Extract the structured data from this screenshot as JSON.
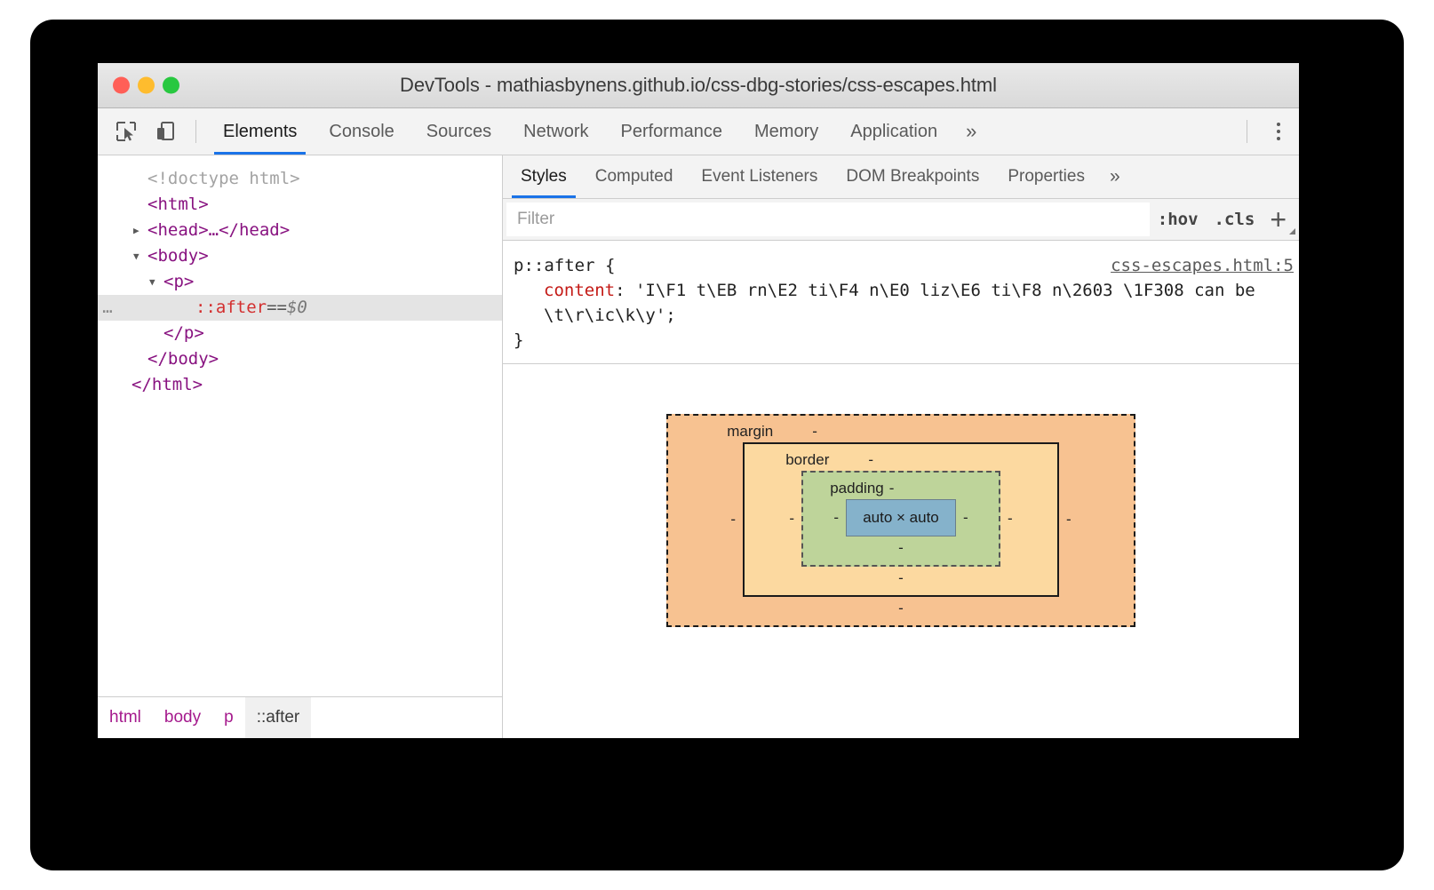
{
  "window": {
    "title": "DevTools - mathiasbynens.github.io/css-dbg-stories/css-escapes.html",
    "traffic_lights": {
      "close": "close-window",
      "minimize": "minimize-window",
      "zoom": "zoom-window"
    }
  },
  "toolbar": {
    "inspect_icon": "inspect-element-icon",
    "device_icon": "device-toolbar-icon",
    "menu_icon": "more-options-kebab-icon",
    "tabs": [
      {
        "label": "Elements",
        "active": true
      },
      {
        "label": "Console",
        "active": false
      },
      {
        "label": "Sources",
        "active": false
      },
      {
        "label": "Network",
        "active": false
      },
      {
        "label": "Performance",
        "active": false
      },
      {
        "label": "Memory",
        "active": false
      },
      {
        "label": "Application",
        "active": false
      }
    ],
    "more_label": "»"
  },
  "dom_tree": {
    "rows": [
      {
        "indent": 1,
        "twisty": "",
        "ellipsis": false,
        "selected": false,
        "parts": [
          {
            "text": "<!doctype html>",
            "cls": "tk-doctype"
          }
        ]
      },
      {
        "indent": 1,
        "twisty": "",
        "ellipsis": false,
        "selected": false,
        "parts": [
          {
            "text": "<html>",
            "cls": "tk-tag"
          }
        ]
      },
      {
        "indent": 1,
        "twisty": "▶",
        "ellipsis": false,
        "selected": false,
        "parts": [
          {
            "text": "<head>…</head>",
            "cls": "tk-tag"
          }
        ]
      },
      {
        "indent": 1,
        "twisty": "▼",
        "ellipsis": false,
        "selected": false,
        "parts": [
          {
            "text": "<body>",
            "cls": "tk-tag"
          }
        ]
      },
      {
        "indent": 2,
        "twisty": "▼",
        "ellipsis": false,
        "selected": false,
        "parts": [
          {
            "text": "<p>",
            "cls": "tk-tag"
          }
        ]
      },
      {
        "indent": 4,
        "twisty": "",
        "ellipsis": true,
        "selected": true,
        "parts": [
          {
            "text": "::after",
            "cls": "tk-pseudo"
          },
          {
            "text": " == ",
            "cls": "tk-eq"
          },
          {
            "text": "$0",
            "cls": "tk-var"
          }
        ]
      },
      {
        "indent": 2,
        "twisty": "",
        "ellipsis": false,
        "selected": false,
        "parts": [
          {
            "text": "</p>",
            "cls": "tk-tag"
          }
        ]
      },
      {
        "indent": 1,
        "twisty": "",
        "ellipsis": false,
        "selected": false,
        "parts": [
          {
            "text": "</body>",
            "cls": "tk-tag"
          }
        ]
      },
      {
        "indent": 0,
        "twisty": "",
        "ellipsis": false,
        "selected": false,
        "parts": [
          {
            "text": "</html>",
            "cls": "tk-tag"
          }
        ]
      }
    ]
  },
  "breadcrumb": {
    "items": [
      {
        "label": "html",
        "selected": false
      },
      {
        "label": "body",
        "selected": false
      },
      {
        "label": "p",
        "selected": false
      },
      {
        "label": "::after",
        "selected": true
      }
    ]
  },
  "styles_pane": {
    "tabs": [
      {
        "label": "Styles",
        "active": true
      },
      {
        "label": "Computed",
        "active": false
      },
      {
        "label": "Event Listeners",
        "active": false
      },
      {
        "label": "DOM Breakpoints",
        "active": false
      },
      {
        "label": "Properties",
        "active": false
      }
    ],
    "more_label": "»",
    "filter": {
      "placeholder": "Filter",
      "value": ""
    },
    "hov_label": ":hov",
    "cls_label": ".cls",
    "new_rule_label": "+",
    "rule": {
      "selector": "p::after {",
      "origin": "css-escapes.html:5",
      "property": "content",
      "colon": ":",
      "value": " 'I\\F1 t\\EB rn\\E2 ti\\F4 n\\E0 liz\\E6 ti\\F8 n\\2603 \\1F308 can be \\t\\r\\ic\\k\\y';",
      "close": "}"
    }
  },
  "box_model": {
    "margin_label": "margin",
    "border_label": "border",
    "padding_label": "padding",
    "content_label": "auto × auto",
    "dash": "-",
    "margin_top": "-",
    "margin_bottom": "-",
    "margin_left": "-",
    "margin_right": "-",
    "border_top": "-",
    "border_bottom": "-",
    "border_left": "-",
    "border_right": "-",
    "padding_top": "-",
    "padding_bottom": "-",
    "padding_left": "-",
    "padding_right": "-",
    "colors": {
      "margin": "#f7c291",
      "border": "#fcd9a0",
      "padding": "#bed49a",
      "content": "#85b2cb"
    }
  },
  "theme": {
    "accent": "#1a73e8",
    "tag_color": "#881280",
    "pseudo_color": "#d32f2f",
    "prop_color": "#c41a16"
  }
}
